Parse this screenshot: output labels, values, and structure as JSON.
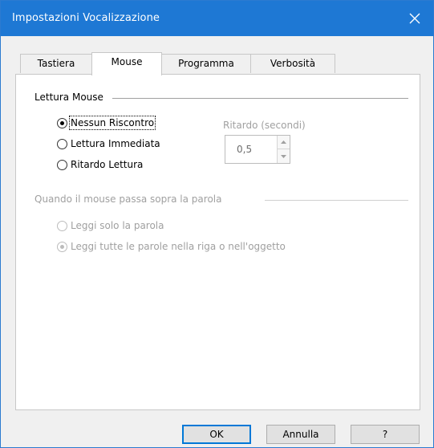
{
  "window": {
    "title": "Impostazioni Vocalizzazione",
    "close_icon": "close-icon",
    "titlebar_color": "#1e78d4"
  },
  "tabs": [
    {
      "label": "Tastiera",
      "active": false
    },
    {
      "label": "Mouse",
      "active": true
    },
    {
      "label": "Programma",
      "active": false
    },
    {
      "label": "Verbosità",
      "active": false
    }
  ],
  "mouse_reading": {
    "group_title": "Lettura Mouse",
    "options": [
      {
        "label": "Nessun Riscontro",
        "checked": true
      },
      {
        "label": "Lettura Immediata",
        "checked": false
      },
      {
        "label": "Ritardo Lettura",
        "checked": false
      }
    ],
    "delay": {
      "label": "Ritardo (secondi)",
      "value": "0,5"
    }
  },
  "hover": {
    "group_title": "Quando il mouse passa sopra la parola",
    "options": [
      {
        "label": "Leggi solo la parola",
        "checked": false
      },
      {
        "label": "Leggi tutte le parole nella riga o nell'oggetto",
        "checked": true
      }
    ]
  },
  "buttons": {
    "ok": "OK",
    "cancel": "Annulla",
    "help": "?"
  }
}
